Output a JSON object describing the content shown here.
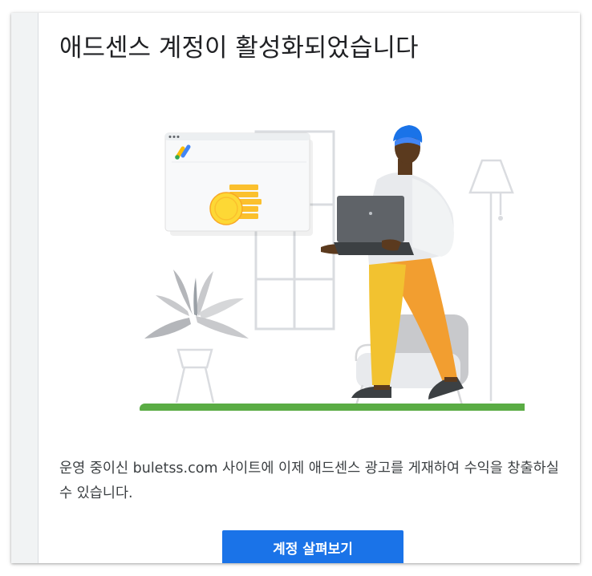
{
  "card": {
    "title": "애드센스 계정이 활성화되었습니다",
    "message": "운영 중이신 buletss.com 사이트에 이제 애드센스 광고를 게재하여 수익을 창출하실 수 있습니다.",
    "cta_label": "계정 살펴보기"
  },
  "illustration": {
    "alt": "person-with-laptop-and-adsense-window",
    "icon": "adsense-logo"
  },
  "colors": {
    "primary": "#1a73e8",
    "title_text": "#202124",
    "body_text": "#3c4043",
    "ground": "#5aac44",
    "coin": "#fbc02d",
    "pants_yellow": "#f2c230",
    "pants_orange": "#f29e30"
  }
}
